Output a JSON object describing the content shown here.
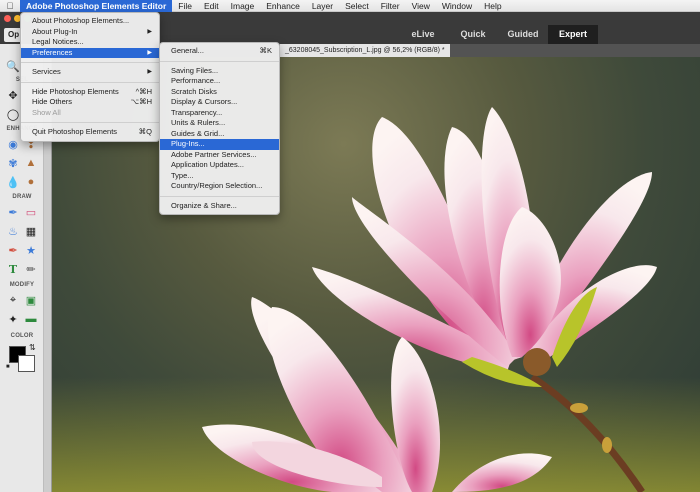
{
  "menubar": {
    "items": [
      {
        "label": "Adobe Photoshop Elements Editor",
        "active": true
      },
      {
        "label": "File"
      },
      {
        "label": "Edit"
      },
      {
        "label": "Image"
      },
      {
        "label": "Enhance"
      },
      {
        "label": "Layer"
      },
      {
        "label": "Select"
      },
      {
        "label": "Filter"
      },
      {
        "label": "View"
      },
      {
        "label": "Window"
      },
      {
        "label": "Help"
      }
    ]
  },
  "header": {
    "open_label": "Op",
    "modes": [
      {
        "label": "eLive",
        "active": false
      },
      {
        "label": "Quick",
        "active": false
      },
      {
        "label": "Guided",
        "active": false
      },
      {
        "label": "Expert",
        "active": true
      }
    ]
  },
  "document_tab": {
    "label": "_63208045_Subscription_L.jpg @ 56,2% (RGB/8) *"
  },
  "toolpanel": {
    "sections": {
      "view": "V",
      "select": "SEL",
      "enhance": "ENHANCE",
      "draw": "DRAW",
      "modify": "MODIFY",
      "color": "COLOR"
    }
  },
  "app_menu": {
    "items": [
      {
        "label": "About Photoshop Elements...",
        "shortcut": "",
        "submenu": false,
        "disabled": false
      },
      {
        "label": "About Plug-In",
        "shortcut": "",
        "submenu": true,
        "disabled": false
      },
      {
        "label": "Legal Notices...",
        "shortcut": "",
        "submenu": false,
        "disabled": false
      },
      {
        "label": "Preferences",
        "shortcut": "",
        "submenu": true,
        "disabled": false,
        "highlighted": true
      },
      {
        "sep": true
      },
      {
        "label": "Services",
        "shortcut": "",
        "submenu": true,
        "disabled": false
      },
      {
        "sep": true
      },
      {
        "label": "Hide Photoshop Elements",
        "shortcut": "^⌘H",
        "submenu": false,
        "disabled": false
      },
      {
        "label": "Hide Others",
        "shortcut": "⌥⌘H",
        "submenu": false,
        "disabled": false
      },
      {
        "label": "Show All",
        "shortcut": "",
        "submenu": false,
        "disabled": true
      },
      {
        "sep": true
      },
      {
        "label": "Quit Photoshop Elements",
        "shortcut": "⌘Q",
        "submenu": false,
        "disabled": false
      }
    ]
  },
  "preferences_menu": {
    "items": [
      {
        "label": "General...",
        "shortcut": "⌘K"
      },
      {
        "sep": true
      },
      {
        "label": "Saving Files..."
      },
      {
        "label": "Performance..."
      },
      {
        "label": "Scratch Disks"
      },
      {
        "label": "Display & Cursors..."
      },
      {
        "label": "Transparency..."
      },
      {
        "label": "Units & Rulers..."
      },
      {
        "label": "Guides & Grid..."
      },
      {
        "label": "Plug-Ins...",
        "highlighted": true
      },
      {
        "label": "Adobe Partner Services..."
      },
      {
        "label": "Application Updates..."
      },
      {
        "label": "Type..."
      },
      {
        "label": "Country/Region Selection..."
      },
      {
        "sep": true
      },
      {
        "label": "Organize & Share..."
      }
    ]
  },
  "colors": {
    "accent": "#2a68d5",
    "foreground_swatch": "#000000",
    "background_swatch": "#ffffff"
  }
}
